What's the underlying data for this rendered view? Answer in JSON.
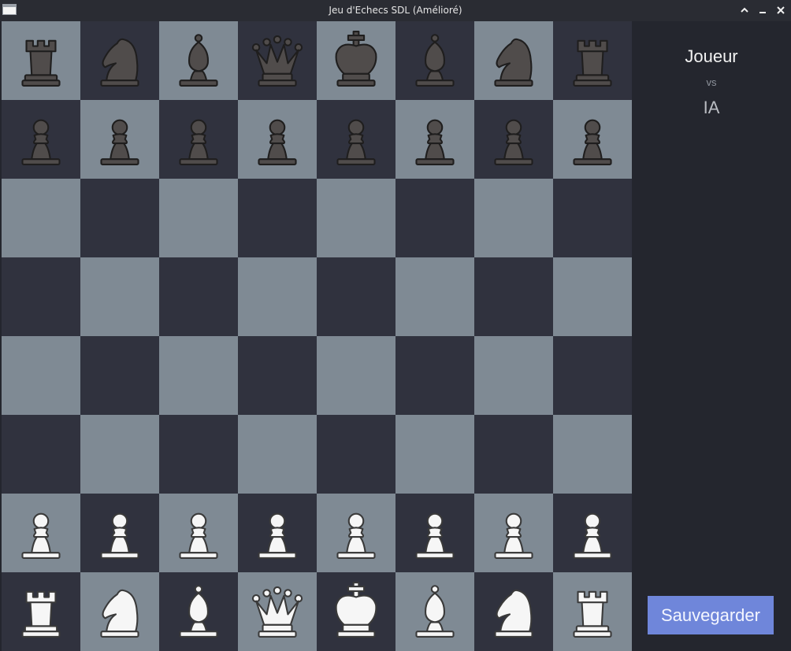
{
  "window": {
    "title": "Jeu d'Echecs SDL (Amélioré)"
  },
  "colors": {
    "light_square": "#7f8a94",
    "dark_square": "#30323e",
    "panel_bg": "#24262e",
    "button_bg": "#6f86da",
    "black_piece": "#504c4b",
    "white_piece": "#f6f6f6"
  },
  "board": {
    "rows": [
      [
        "br",
        "bn",
        "bb",
        "bq",
        "bk",
        "bb",
        "bn",
        "br"
      ],
      [
        "bp",
        "bp",
        "bp",
        "bp",
        "bp",
        "bp",
        "bp",
        "bp"
      ],
      [
        "",
        "",
        "",
        "",
        "",
        "",
        "",
        ""
      ],
      [
        "",
        "",
        "",
        "",
        "",
        "",
        "",
        ""
      ],
      [
        "",
        "",
        "",
        "",
        "",
        "",
        "",
        ""
      ],
      [
        "",
        "",
        "",
        "",
        "",
        "",
        "",
        ""
      ],
      [
        "wp",
        "wp",
        "wp",
        "wp",
        "wp",
        "wp",
        "wp",
        "wp"
      ],
      [
        "wr",
        "wn",
        "wb",
        "wq",
        "wk",
        "wb",
        "wn",
        "wr"
      ]
    ]
  },
  "side_panel": {
    "player1": "Joueur",
    "vs": "vs",
    "player2": "IA",
    "save_label": "Sauvegarder"
  }
}
